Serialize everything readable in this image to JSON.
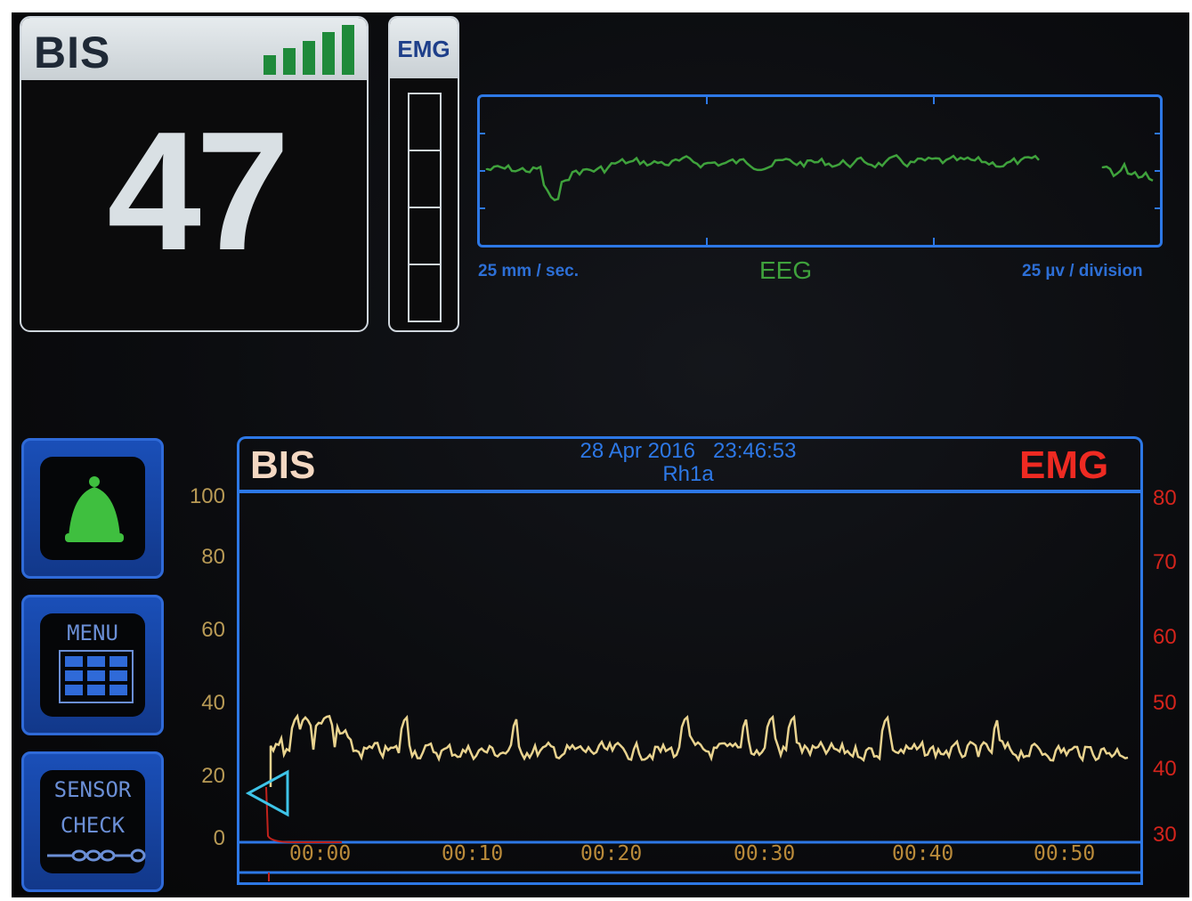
{
  "bis_panel": {
    "label": "BIS",
    "value": "47"
  },
  "emg_meter": {
    "label": "EMG"
  },
  "eeg": {
    "speed": "25 mm / sec.",
    "title": "EEG",
    "scale": "25 µv / division"
  },
  "side_buttons": {
    "menu_label": "MENU",
    "sensor_line1": "SENSOR",
    "sensor_line2": "CHECK"
  },
  "trend": {
    "bis_label": "BIS",
    "emg_label": "EMG",
    "date": "28 Apr 2016",
    "time": "23:46:53",
    "patient": "Rh1a",
    "left_axis_ticks": [
      "100",
      "80",
      "60",
      "40",
      "20",
      "0"
    ],
    "right_axis_ticks": [
      "80",
      "70",
      "60",
      "50",
      "40",
      "30"
    ],
    "time_ticks": [
      "00:00",
      "00:10",
      "00:20",
      "00:30",
      "00:40",
      "00:50"
    ]
  },
  "colors": {
    "accent": "#2d78e6",
    "bis_trend": "#e9d38f",
    "eeg_wave": "#3fa23c",
    "emg_trend": "#d4241c",
    "alarm_bell": "#3fbf3f"
  }
}
